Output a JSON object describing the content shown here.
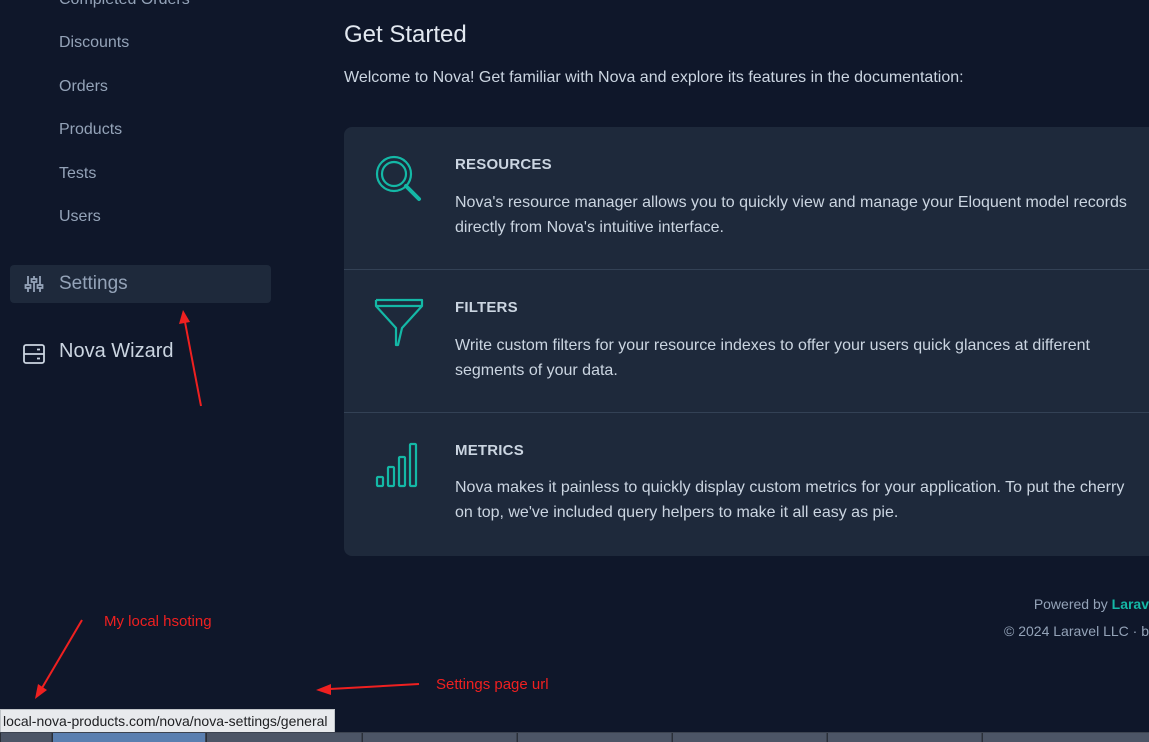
{
  "sidebar": {
    "items": [
      "Completed Orders",
      "Discounts",
      "Orders",
      "Products",
      "Tests",
      "Users"
    ],
    "settings_label": "Settings",
    "wizard_label": "Nova Wizard"
  },
  "main": {
    "title": "Get Started",
    "welcome": "Welcome to Nova! Get familiar with Nova and explore its features in the documentation:",
    "features": [
      {
        "title": "RESOURCES",
        "icon": "search-icon",
        "body": "Nova's resource manager allows you to quickly view and manage your Eloquent model records directly from Nova's intuitive interface."
      },
      {
        "title": "FILTERS",
        "icon": "filter-icon",
        "body": "Write custom filters for your resource indexes to offer your users quick glances at different segments of your data."
      },
      {
        "title": "METRICS",
        "icon": "bar-chart-icon",
        "body": "Nova makes it painless to quickly display custom metrics for your application. To put the cherry on top, we've included query helpers to make it all easy as pie."
      }
    ]
  },
  "footer": {
    "powered_prefix": "Powered by ",
    "powered_brand": "Larav",
    "copyright": "© 2024 Laravel LLC · b"
  },
  "annotations": {
    "local_hosting": "My local hsoting",
    "settings_url_note": "Settings page url"
  },
  "status_bar": {
    "url": "local-nova-products.com/nova/nova-settings/general"
  },
  "colors": {
    "background": "#0f172a",
    "card": "#1e293b",
    "accent": "#14b8a6",
    "annotation": "#ef2020"
  }
}
